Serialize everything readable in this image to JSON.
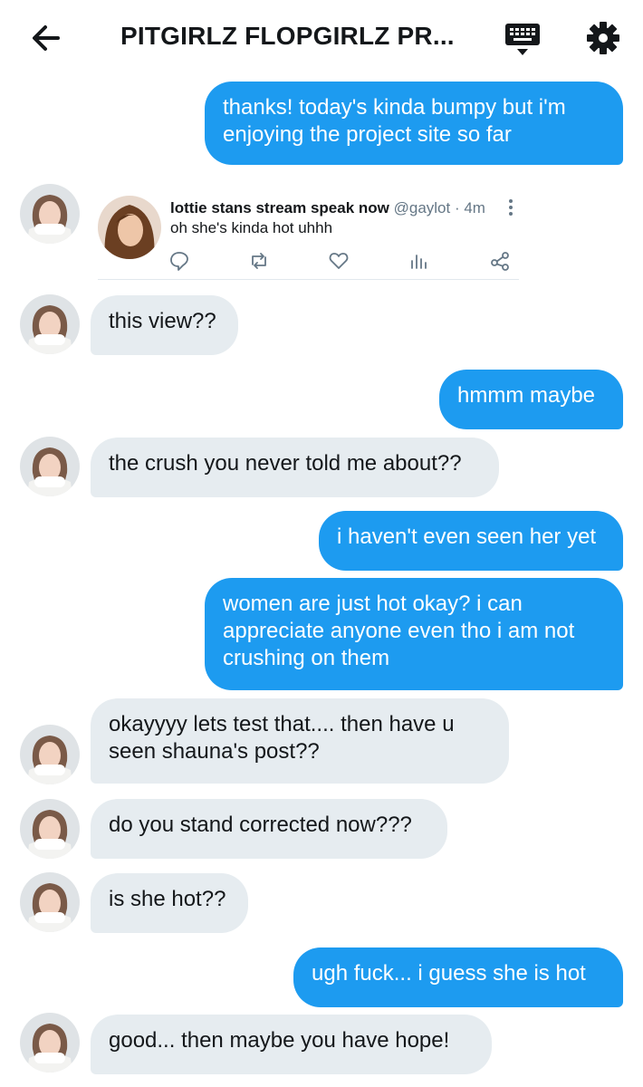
{
  "header": {
    "title": "PITGIRLZ FLOPGIRLZ PR...",
    "back_icon": "arrow-left-icon",
    "keyboard_icon": "keyboard-icon",
    "settings_icon": "gear-icon"
  },
  "colors": {
    "outgoing_bubble": "#1d9bf0",
    "incoming_bubble": "#e6ecf0",
    "text": "#14171a",
    "secondary_text": "#657786"
  },
  "messages": [
    {
      "direction": "out",
      "lines": [
        "thanks! today's kinda bumpy but i'm",
        "enjoying the project site so far"
      ]
    },
    {
      "direction": "in",
      "type": "tweet"
    },
    {
      "direction": "in",
      "lines": [
        "this view??"
      ]
    },
    {
      "direction": "out",
      "lines": [
        "hmmm maybe"
      ]
    },
    {
      "direction": "in",
      "lines": [
        "the crush you never told me about??"
      ]
    },
    {
      "direction": "out",
      "lines": [
        "i haven't even seen her yet"
      ]
    },
    {
      "direction": "out",
      "lines": [
        "women are just hot okay? i can",
        "appreciate anyone even tho i am not",
        "crushing on them"
      ]
    },
    {
      "direction": "in",
      "lines": [
        "okayyyy lets test that.... then have u",
        "seen shauna's post??"
      ]
    },
    {
      "direction": "in",
      "lines": [
        "do you stand corrected now???"
      ]
    },
    {
      "direction": "in",
      "lines": [
        "is she hot??"
      ]
    },
    {
      "direction": "out",
      "lines": [
        "ugh fuck... i guess she is hot"
      ]
    },
    {
      "direction": "in",
      "lines": [
        "good... then maybe you have hope!"
      ]
    }
  ],
  "shared_tweet": {
    "display_name": "lottie stans stream speak now",
    "handle": "@gaylot",
    "time": "· 4m",
    "text": "oh she's kinda hot uhhh",
    "actions": [
      "reply-icon",
      "retweet-icon",
      "like-icon",
      "analytics-icon",
      "share-icon"
    ]
  }
}
